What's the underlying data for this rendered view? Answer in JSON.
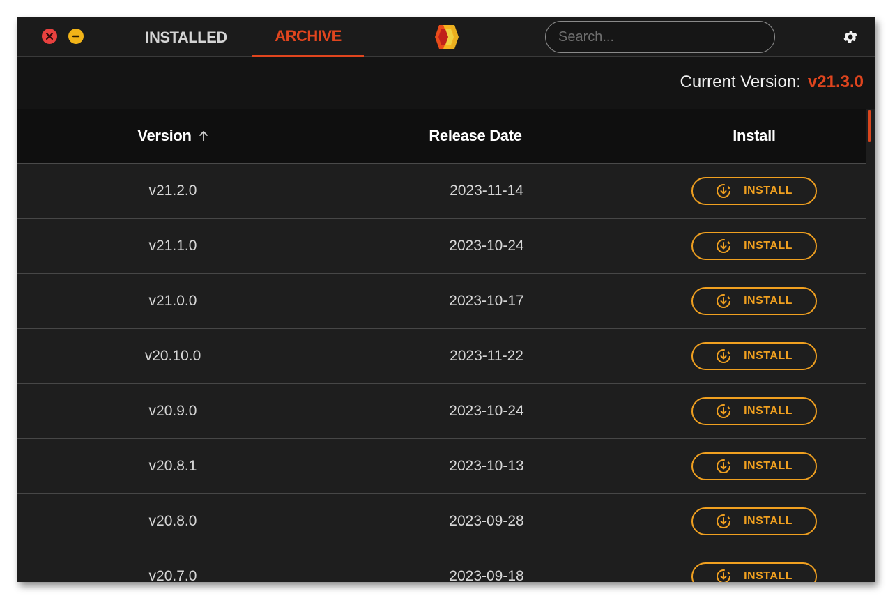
{
  "window_controls": {
    "close": "close-icon",
    "minimize": "minimize-icon"
  },
  "tabs": [
    {
      "label": "INSTALLED",
      "active": false
    },
    {
      "label": "ARCHIVE",
      "active": true
    }
  ],
  "logo": "app-logo",
  "search": {
    "placeholder": "Search...",
    "value": ""
  },
  "settings": "gear-icon",
  "current_version": {
    "label": "Current Version:",
    "value": "v21.3.0"
  },
  "table": {
    "columns": [
      {
        "label": "Version",
        "sort": "ascending"
      },
      {
        "label": "Release Date"
      },
      {
        "label": "Install"
      }
    ],
    "rows": [
      {
        "version": "v21.2.0",
        "date": "2023-11-14",
        "action": "INSTALL"
      },
      {
        "version": "v21.1.0",
        "date": "2023-10-24",
        "action": "INSTALL"
      },
      {
        "version": "v21.0.0",
        "date": "2023-10-17",
        "action": "INSTALL"
      },
      {
        "version": "v20.10.0",
        "date": "2023-11-22",
        "action": "INSTALL"
      },
      {
        "version": "v20.9.0",
        "date": "2023-10-24",
        "action": "INSTALL"
      },
      {
        "version": "v20.8.1",
        "date": "2023-10-13",
        "action": "INSTALL"
      },
      {
        "version": "v20.8.0",
        "date": "2023-09-28",
        "action": "INSTALL"
      },
      {
        "version": "v20.7.0",
        "date": "2023-09-18",
        "action": "INSTALL"
      }
    ]
  },
  "colors": {
    "accent": "#e0451e",
    "install": "#f0a020",
    "close": "#e8413f",
    "minimize": "#f2b418"
  }
}
